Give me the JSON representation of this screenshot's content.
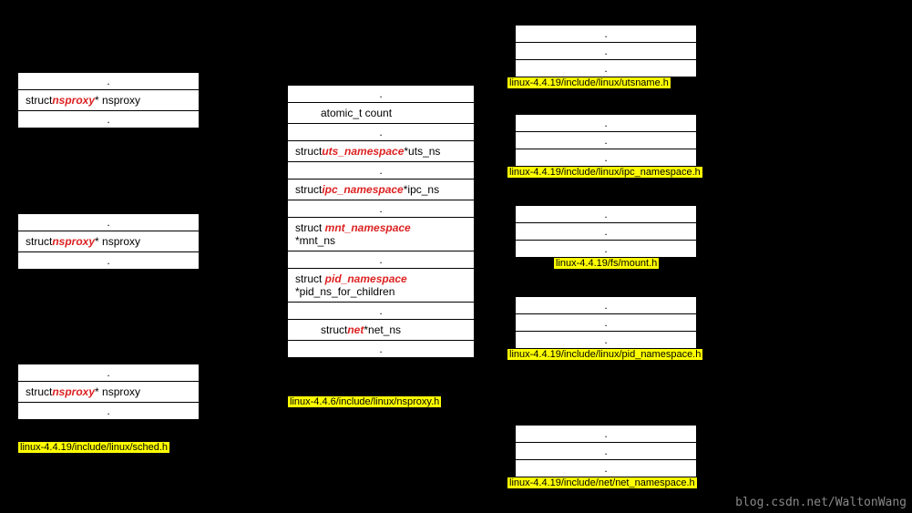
{
  "task": {
    "field_prefix": "struct ",
    "field_em": "nsproxy",
    "field_suffix": "* nsproxy",
    "caption": "linux-4.4.19/include/linux/sched.h"
  },
  "nsproxy": {
    "count": "atomic_t  count",
    "uts_prefix": "struct ",
    "uts_em": "uts_namespace",
    "uts_suffix": " *uts_ns",
    "ipc_prefix": "struct ",
    "ipc_em": "ipc_namespace",
    "ipc_suffix": " *ipc_ns",
    "mnt_prefix": "struct ",
    "mnt_em": "mnt_namespace",
    "mnt_line2": "*mnt_ns",
    "pid_prefix": "struct ",
    "pid_em": "pid_namespace",
    "pid_line2": "*pid_ns_for_children",
    "net_prefix": "struct ",
    "net_em": "net",
    "net_suffix": "   *net_ns",
    "caption": "linux-4.4.6/include/linux/nsproxy.h"
  },
  "targets": {
    "uts": "linux-4.4.19/include/linux/utsname.h",
    "ipc": "linux-4.4.19/include/linux/ipc_namespace.h",
    "mnt": "linux-4.4.19/fs/mount.h",
    "pid": "linux-4.4.19/include/linux/pid_namespace.h",
    "net": "linux-4.4.19/include/net/net_namespace.h"
  },
  "watermark": "blog.csdn.net/WaltonWang"
}
